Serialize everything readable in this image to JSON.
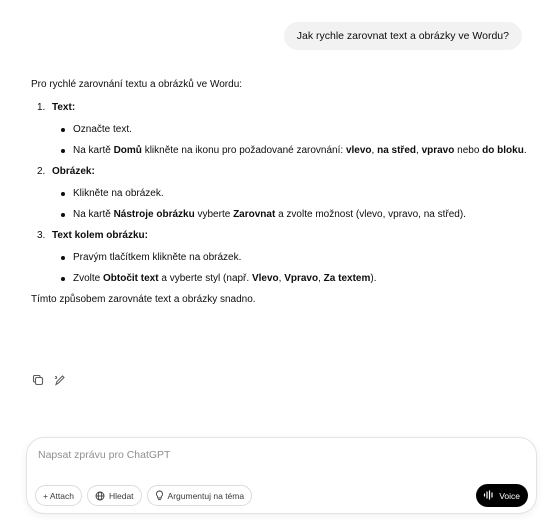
{
  "user_message": "Jak rychle zarovnat text a obrázky ve Wordu?",
  "answer": {
    "intro": "Pro rychlé zarovnání textu a obrázků ve Wordu:",
    "steps": [
      {
        "number": "1.",
        "title": "Text:",
        "bullets": [
          {
            "plain1": "Označte text."
          },
          {
            "plain1": "Na kartě ",
            "bold1": "Domů",
            "plain2": " klikněte na ikonu pro požadované zarovnání: ",
            "bold2": "vlevo",
            "plain3": ", ",
            "bold3": "na střed",
            "plain4": ", ",
            "bold4": "vpravo",
            "plain5": " nebo ",
            "bold5": "do bloku",
            "plain6": "."
          }
        ]
      },
      {
        "number": "2.",
        "title": "Obrázek:",
        "bullets": [
          {
            "plain1": "Klikněte na obrázek."
          },
          {
            "plain1": "Na kartě ",
            "bold1": "Nástroje obrázku",
            "plain2": " vyberte ",
            "bold2": "Zarovnat",
            "plain3": " a zvolte možnost (vlevo, vpravo, na střed)."
          }
        ]
      },
      {
        "number": "3.",
        "title": "Text kolem obrázku:",
        "bullets": [
          {
            "plain1": "Pravým tlačítkem klikněte na obrázek."
          },
          {
            "plain1": "Zvolte ",
            "bold1": "Obtočit text",
            "plain2": " a vyberte styl (např. ",
            "bold2": "Vlevo",
            "plain3": ", ",
            "bold3": "Vpravo",
            "plain4": ", ",
            "bold4": "Za textem",
            "plain5": ")."
          }
        ]
      }
    ],
    "outro": "Tímto způsobem zarovnáte text a obrázky snadno."
  },
  "message_actions": {
    "copy_icon": "copy-icon",
    "edit_icon": "edit-icon"
  },
  "composer": {
    "placeholder": "Napsat zprávu pro ChatGPT",
    "value": "",
    "tools": {
      "attach_label": "+ Attach",
      "search_label": "Hledat",
      "search_icon": "globe-icon",
      "reason_label": "Argumentuj na téma",
      "reason_icon": "lightbulb-icon"
    },
    "voice_label": "Voice",
    "voice_icon": "waveform-icon"
  }
}
